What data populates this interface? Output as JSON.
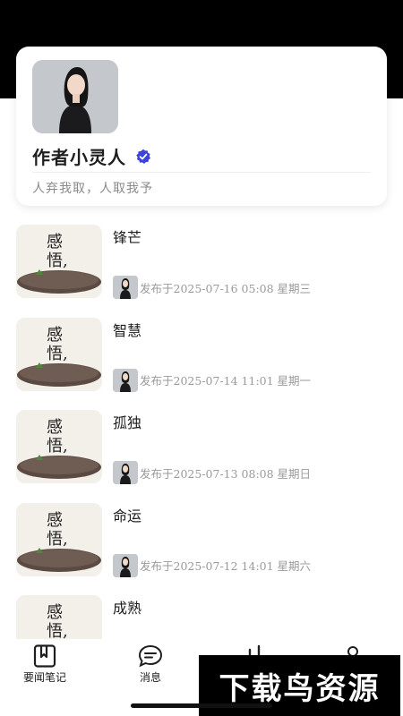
{
  "profile": {
    "author_name": "作者小灵人",
    "motto": "人弃我取，人取我予",
    "verified_color": "#3b44d6"
  },
  "articles": [
    {
      "title": "锋芒",
      "meta": "发布于2025-07-16 05:08 星期三"
    },
    {
      "title": "智慧",
      "meta": "发布于2025-07-14 11:01 星期一"
    },
    {
      "title": "孤独",
      "meta": "发布于2025-07-13 08:08 星期日"
    },
    {
      "title": "命运",
      "meta": "发布于2025-07-12 14:01 星期六"
    },
    {
      "title": "成熟",
      "meta": ""
    }
  ],
  "thumbnail_text": "感悟,",
  "tabs": [
    {
      "label": "要闻笔记",
      "icon": "notebook-icon"
    },
    {
      "label": "消息",
      "icon": "message-icon"
    },
    {
      "label": "",
      "icon": "chart-icon"
    },
    {
      "label": "",
      "icon": "user-icon"
    }
  ],
  "watermark": "下载鸟资源"
}
